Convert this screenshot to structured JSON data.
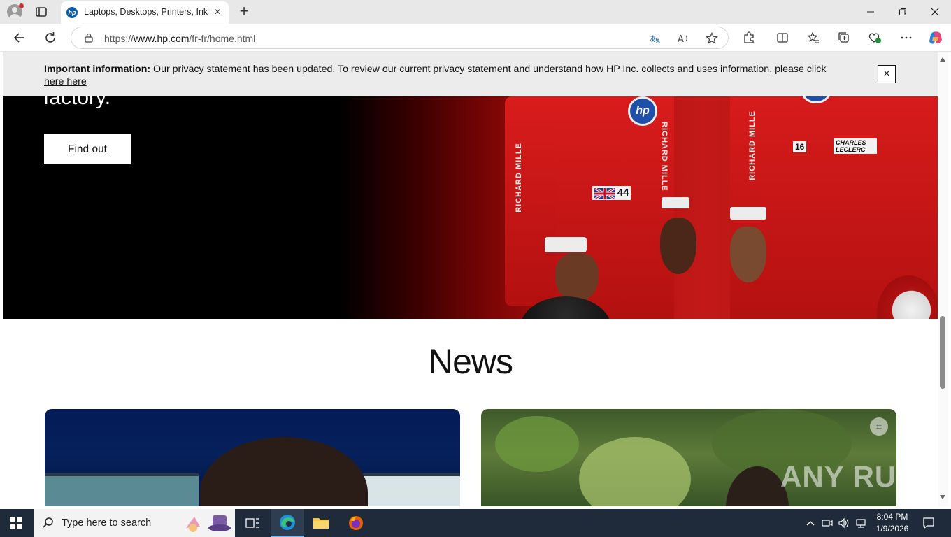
{
  "browser": {
    "tab_title": "Laptops, Desktops, Printers, Ink & Toner | HP® France",
    "tab_favicon": "hp",
    "url_prefix": "https://",
    "url_host": "www.hp.com",
    "url_path": "/fr-fr/home.html"
  },
  "privacy_banner": {
    "label": "Important information:",
    "message": " Our privacy statement has been updated. To review our current privacy statement and understand how HP Inc. collects and uses information, please click ",
    "link": "here here",
    "close": "×"
  },
  "hero": {
    "heading_fragment": "factory.",
    "cta": "Find out",
    "patch_left": "44",
    "patch_right_num": "16",
    "patch_right_name": "CHARLES LECLERC",
    "sleeve_text": "RICHARD MILLE",
    "badge": "hp"
  },
  "news": {
    "title": "News"
  },
  "watermark": "ANY RUN",
  "taskbar": {
    "search_placeholder": "Type here to search",
    "time": "8:04 PM",
    "date": "1/9/2026"
  },
  "colors": {
    "hero_red": "#c21818",
    "taskbar": "#1f2b3a",
    "banner_bg": "#ececec",
    "hp_blue": "#1f4fa8"
  }
}
